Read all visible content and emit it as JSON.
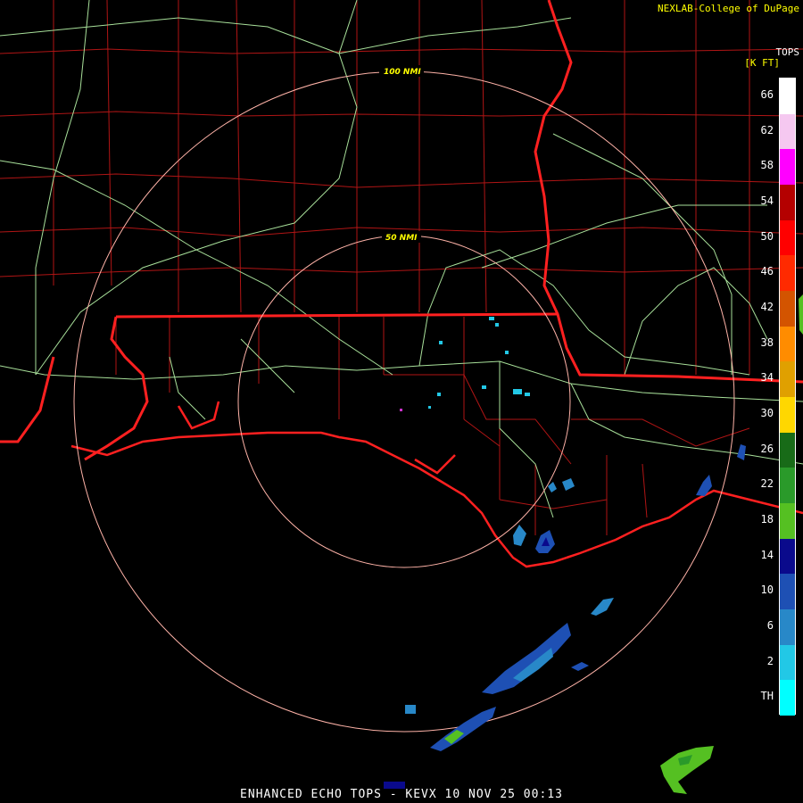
{
  "credit": "NEXLAB-College of DuPage",
  "product": {
    "footer": "ENHANCED ECHO TOPS - KEVX 10 NOV 25 00:13"
  },
  "legend": {
    "title": "TOPS",
    "unit": "[K FT]",
    "ticks": [
      "66",
      "62",
      "58",
      "54",
      "50",
      "46",
      "42",
      "38",
      "34",
      "30",
      "26",
      "22",
      "18",
      "14",
      "10",
      "6",
      "2",
      "TH"
    ],
    "colors": [
      "#ffffff",
      "#f5c8f0",
      "#ff00ff",
      "#b40000",
      "#ff0000",
      "#ff2a00",
      "#d35400",
      "#ff8c00",
      "#e0a000",
      "#ffd700",
      "#186b18",
      "#2a9a2a",
      "#55c022",
      "#0a0a8c",
      "#1e50b4",
      "#2888c8",
      "#22c8e6",
      "#00ffff"
    ]
  },
  "radar": {
    "site": "KEVX",
    "rings": [
      {
        "label": "100 NMI"
      },
      {
        "label": "50 NMI"
      }
    ]
  }
}
